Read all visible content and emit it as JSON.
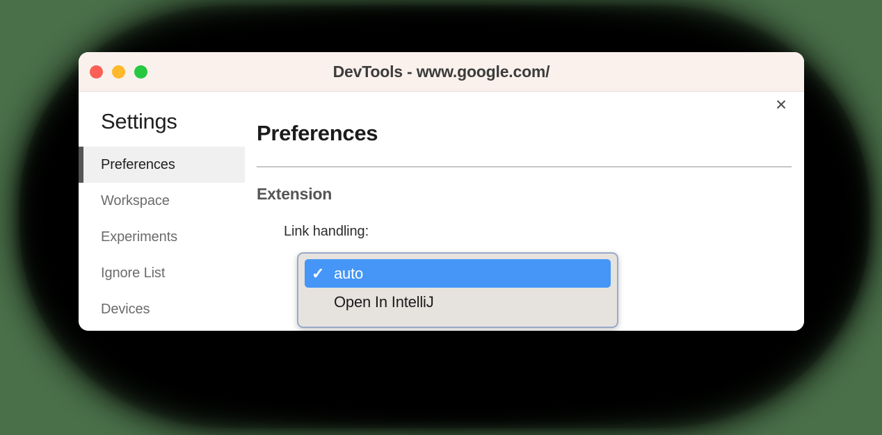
{
  "window": {
    "title": "DevTools - www.google.com/",
    "traffic_lights": [
      {
        "name": "close",
        "color": "#fa6055"
      },
      {
        "name": "minimize",
        "color": "#fdb92b"
      },
      {
        "name": "zoom",
        "color": "#28c840"
      }
    ]
  },
  "sidebar": {
    "title": "Settings",
    "items": [
      {
        "label": "Preferences",
        "selected": true
      },
      {
        "label": "Workspace",
        "selected": false
      },
      {
        "label": "Experiments",
        "selected": false
      },
      {
        "label": "Ignore List",
        "selected": false
      },
      {
        "label": "Devices",
        "selected": false
      }
    ]
  },
  "content": {
    "title": "Preferences",
    "close_label": "✕",
    "section_title": "Extension",
    "field_label": "Link handling:"
  },
  "select_popup": {
    "options": [
      {
        "label": "auto",
        "selected": true,
        "check": "✓"
      },
      {
        "label": "Open In IntelliJ",
        "selected": false,
        "check": "✓"
      }
    ]
  },
  "colors": {
    "desktop_background": "#4a7049",
    "titlebar": "#faf1ec",
    "accent_blue": "#4596f7",
    "selected_row": "#f0f0f0",
    "selected_bar": "#555555"
  }
}
